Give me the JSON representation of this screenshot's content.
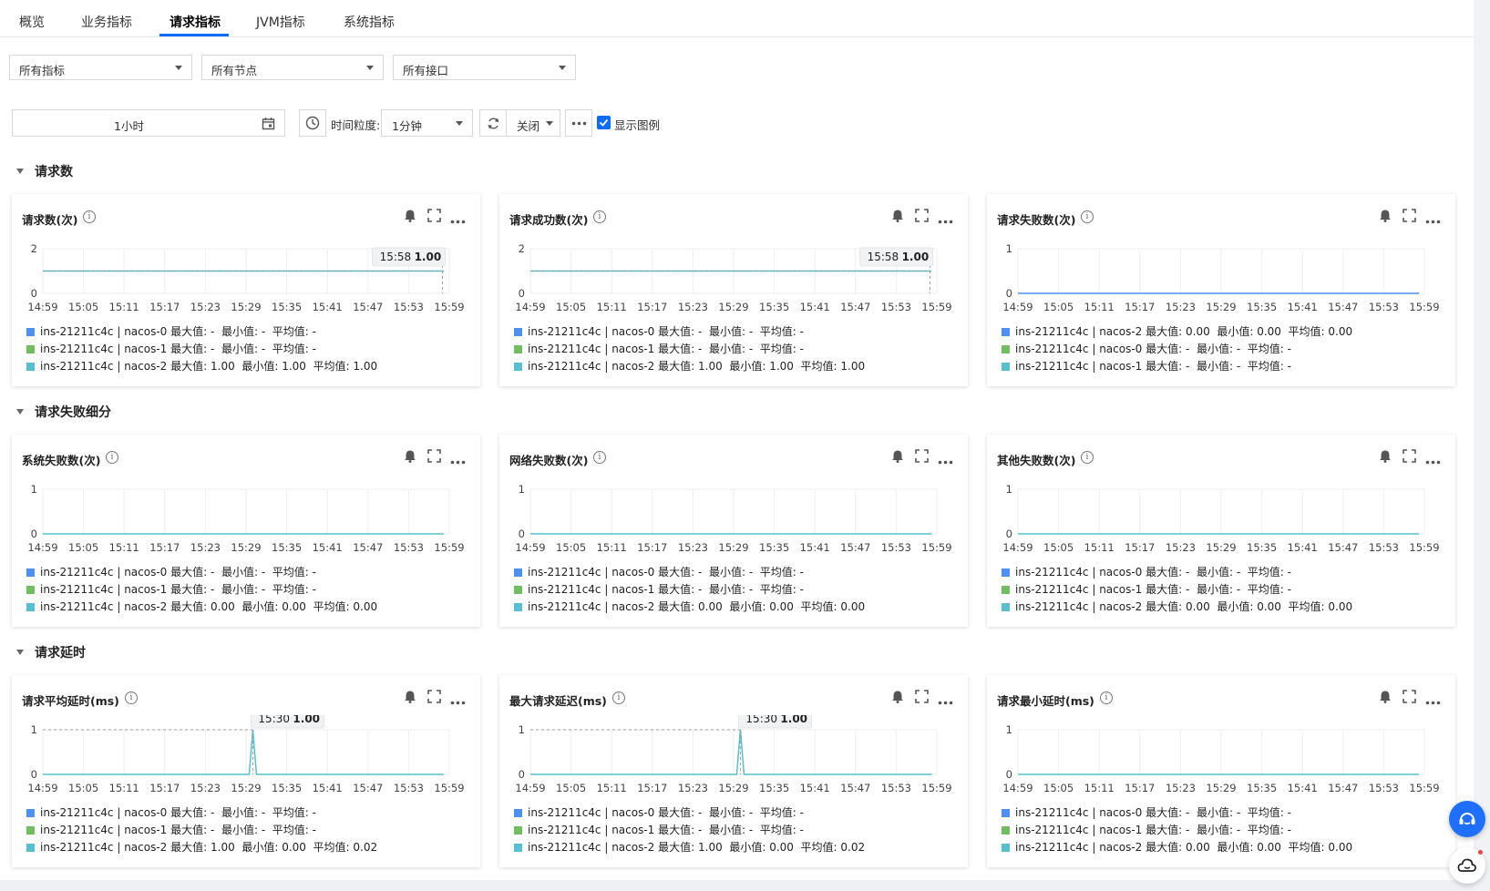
{
  "tabs": [
    "概览",
    "业务指标",
    "请求指标",
    "JVM指标",
    "系统指标"
  ],
  "active_tab": 2,
  "filters": {
    "metric": "所有指标",
    "node": "所有节点",
    "api": "所有接口"
  },
  "toolbar": {
    "time_range": "1小时",
    "granularity_label": "时间粒度:",
    "granularity": "1分钟",
    "refresh": "关闭",
    "show_legend_label": "显示图例",
    "show_legend_checked": true
  },
  "colors": {
    "accent": "#0a6cff",
    "series": [
      "#4c8ff5",
      "#6fbf5f",
      "#56c0d0"
    ]
  },
  "sections": [
    {
      "title": "请求数"
    },
    {
      "title": "请求失败细分"
    },
    {
      "title": "请求延时"
    }
  ],
  "x_ticks": [
    "14:59",
    "15:05",
    "15:11",
    "15:17",
    "15:23",
    "15:29",
    "15:35",
    "15:41",
    "15:47",
    "15:53",
    "15:59"
  ],
  "cards": [
    {
      "title": "请求数(次)",
      "ymax": "2",
      "ymin": "0",
      "ymax_value": 2,
      "line_value": 1,
      "spike": false,
      "tooltip": {
        "time": "15:58",
        "value": "1.00"
      },
      "legend": [
        {
          "name": "ins-21211c4c | nacos-0",
          "stats": "最大值: -  最小值: -  平均值: -",
          "color": "#4c8ff5"
        },
        {
          "name": "ins-21211c4c | nacos-1",
          "stats": "最大值: -  最小值: -  平均值: -",
          "color": "#6fbf5f"
        },
        {
          "name": "ins-21211c4c | nacos-2",
          "stats": "最大值: 1.00  最小值: 1.00  平均值: 1.00",
          "color": "#56c0d0"
        }
      ]
    },
    {
      "title": "请求成功数(次)",
      "ymax": "2",
      "ymin": "0",
      "ymax_value": 2,
      "line_value": 1,
      "spike": false,
      "tooltip": {
        "time": "15:58",
        "value": "1.00"
      },
      "legend": [
        {
          "name": "ins-21211c4c | nacos-0",
          "stats": "最大值: -  最小值: -  平均值: -",
          "color": "#4c8ff5"
        },
        {
          "name": "ins-21211c4c | nacos-1",
          "stats": "最大值: -  最小值: -  平均值: -",
          "color": "#6fbf5f"
        },
        {
          "name": "ins-21211c4c | nacos-2",
          "stats": "最大值: 1.00  最小值: 1.00  平均值: 1.00",
          "color": "#56c0d0"
        }
      ]
    },
    {
      "title": "请求失败数(次)",
      "ymax": "1",
      "ymin": "0",
      "ymax_value": 1,
      "line_value": 0,
      "spike": false,
      "line_color": "#4c8ff5",
      "tooltip": null,
      "legend": [
        {
          "name": "ins-21211c4c | nacos-2",
          "stats": "最大值: 0.00  最小值: 0.00  平均值: 0.00",
          "color": "#4c8ff5"
        },
        {
          "name": "ins-21211c4c | nacos-0",
          "stats": "最大值: -  最小值: -  平均值: -",
          "color": "#6fbf5f"
        },
        {
          "name": "ins-21211c4c | nacos-1",
          "stats": "最大值: -  最小值: -  平均值: -",
          "color": "#56c0d0"
        }
      ]
    },
    {
      "title": "系统失败数(次)",
      "ymax": "1",
      "ymin": "0",
      "ymax_value": 1,
      "line_value": 0,
      "spike": false,
      "tooltip": null,
      "legend": [
        {
          "name": "ins-21211c4c | nacos-0",
          "stats": "最大值: -  最小值: -  平均值: -",
          "color": "#4c8ff5"
        },
        {
          "name": "ins-21211c4c | nacos-1",
          "stats": "最大值: -  最小值: -  平均值: -",
          "color": "#6fbf5f"
        },
        {
          "name": "ins-21211c4c | nacos-2",
          "stats": "最大值: 0.00  最小值: 0.00  平均值: 0.00",
          "color": "#56c0d0"
        }
      ]
    },
    {
      "title": "网络失败数(次)",
      "ymax": "1",
      "ymin": "0",
      "ymax_value": 1,
      "line_value": 0,
      "spike": false,
      "tooltip": null,
      "legend": [
        {
          "name": "ins-21211c4c | nacos-0",
          "stats": "最大值: -  最小值: -  平均值: -",
          "color": "#4c8ff5"
        },
        {
          "name": "ins-21211c4c | nacos-1",
          "stats": "最大值: -  最小值: -  平均值: -",
          "color": "#6fbf5f"
        },
        {
          "name": "ins-21211c4c | nacos-2",
          "stats": "最大值: 0.00  最小值: 0.00  平均值: 0.00",
          "color": "#56c0d0"
        }
      ]
    },
    {
      "title": "其他失败数(次)",
      "ymax": "1",
      "ymin": "0",
      "ymax_value": 1,
      "line_value": 0,
      "spike": false,
      "tooltip": null,
      "legend": [
        {
          "name": "ins-21211c4c | nacos-0",
          "stats": "最大值: -  最小值: -  平均值: -",
          "color": "#4c8ff5"
        },
        {
          "name": "ins-21211c4c | nacos-1",
          "stats": "最大值: -  最小值: -  平均值: -",
          "color": "#6fbf5f"
        },
        {
          "name": "ins-21211c4c | nacos-2",
          "stats": "最大值: 0.00  最小值: 0.00  平均值: 0.00",
          "color": "#56c0d0"
        }
      ]
    },
    {
      "title": "请求平均延时(ms)",
      "ymax": "1",
      "ymin": "0",
      "ymax_value": 1,
      "line_value": 0,
      "spike": true,
      "spike_time": "15:30",
      "spike_value": 1,
      "tooltip": {
        "time": "15:30",
        "value": "1.00"
      },
      "legend": [
        {
          "name": "ins-21211c4c | nacos-0",
          "stats": "最大值: -  最小值: -  平均值: -",
          "color": "#4c8ff5"
        },
        {
          "name": "ins-21211c4c | nacos-1",
          "stats": "最大值: -  最小值: -  平均值: -",
          "color": "#6fbf5f"
        },
        {
          "name": "ins-21211c4c | nacos-2",
          "stats": "最大值: 1.00  最小值: 0.00  平均值: 0.02",
          "color": "#56c0d0"
        }
      ]
    },
    {
      "title": "最大请求延迟(ms)",
      "ymax": "1",
      "ymin": "0",
      "ymax_value": 1,
      "line_value": 0,
      "spike": true,
      "spike_time": "15:30",
      "spike_value": 1,
      "tooltip": {
        "time": "15:30",
        "value": "1.00"
      },
      "legend": [
        {
          "name": "ins-21211c4c | nacos-0",
          "stats": "最大值: -  最小值: -  平均值: -",
          "color": "#4c8ff5"
        },
        {
          "name": "ins-21211c4c | nacos-1",
          "stats": "最大值: -  最小值: -  平均值: -",
          "color": "#6fbf5f"
        },
        {
          "name": "ins-21211c4c | nacos-2",
          "stats": "最大值: 1.00  最小值: 0.00  平均值: 0.02",
          "color": "#56c0d0"
        }
      ]
    },
    {
      "title": "请求最小延时(ms)",
      "ymax": "1",
      "ymin": "0",
      "ymax_value": 1,
      "line_value": 0,
      "spike": false,
      "tooltip": null,
      "legend": [
        {
          "name": "ins-21211c4c | nacos-0",
          "stats": "最大值: -  最小值: -  平均值: -",
          "color": "#4c8ff5"
        },
        {
          "name": "ins-21211c4c | nacos-1",
          "stats": "最大值: -  最小值: -  平均值: -",
          "color": "#6fbf5f"
        },
        {
          "name": "ins-21211c4c | nacos-2",
          "stats": "最大值: 0.00  最小值: 0.00  平均值: 0.00",
          "color": "#56c0d0"
        }
      ]
    }
  ]
}
